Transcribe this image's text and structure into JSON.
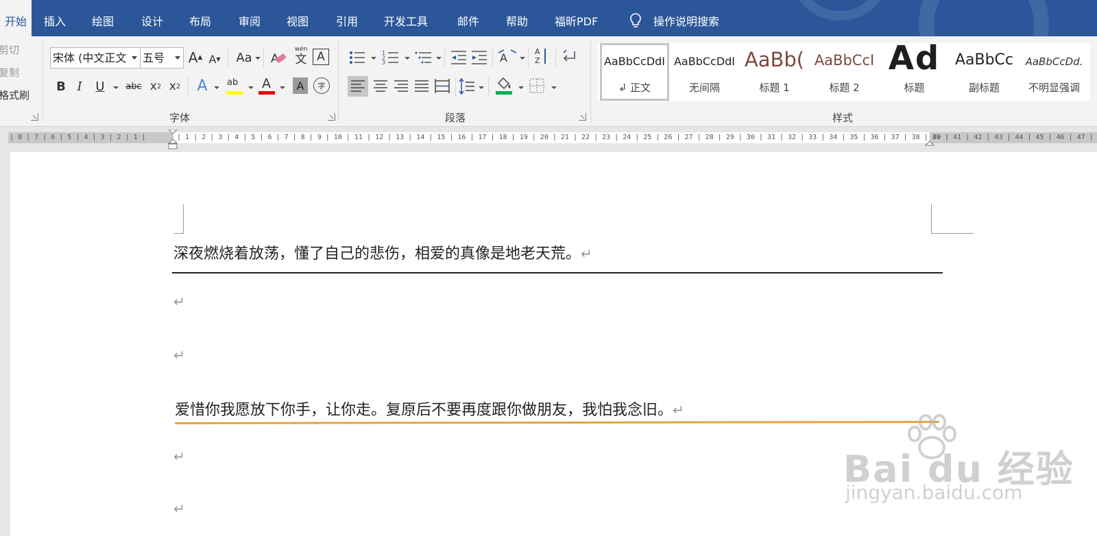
{
  "tabs": [
    {
      "label": "开始",
      "active": true
    },
    {
      "label": "插入"
    },
    {
      "label": "绘图"
    },
    {
      "label": "设计"
    },
    {
      "label": "布局"
    },
    {
      "label": "审阅"
    },
    {
      "label": "视图"
    },
    {
      "label": "引用"
    },
    {
      "label": "开发工具"
    },
    {
      "label": "邮件"
    },
    {
      "label": "帮助"
    },
    {
      "label": "福昕PDF"
    }
  ],
  "tell_me": {
    "label": "操作说明搜索",
    "icon": "lightbulb-icon"
  },
  "clipboard": {
    "cut": "剪切",
    "copy": "复制",
    "format_painter": "格式刷"
  },
  "font_group": {
    "label": "字体",
    "font_name": "宋体 (中文正文",
    "font_size": "五号",
    "grow": "A",
    "shrink": "A",
    "case": "Aa",
    "phonetic_top": "wén",
    "phonetic_char": "文",
    "border_char": "A",
    "bold": "B",
    "italic": "I",
    "underline": "U",
    "strike": "abc",
    "subscript": "x",
    "sub_mark": "2",
    "superscript": "x",
    "sup_mark": "2",
    "effects": "A",
    "highlight": "ab",
    "font_color": "A",
    "shading": "A",
    "enclose": "字"
  },
  "paragraph_group": {
    "label": "段落",
    "sort": "A Z"
  },
  "styles_group": {
    "label": "样式",
    "items": [
      {
        "preview": "AaBbCcDdI",
        "name": "↲ 正文"
      },
      {
        "preview": "AaBbCcDdI",
        "name": "无间隔"
      },
      {
        "preview": "AaBb(",
        "name": "标题 1"
      },
      {
        "preview": "AaBbCcI",
        "name": "标题 2"
      },
      {
        "preview": "Ad",
        "name": "标题"
      },
      {
        "preview": "AaBbCc",
        "name": "副标题"
      },
      {
        "preview": "AaBbCcDd.",
        "name": "不明显强调"
      }
    ]
  },
  "ruler": {
    "left_text": "| 8 | 7 | 6 | 5 | 4 | 3 | 2 | 1 |",
    "main_text": "| 1 | 2 | 3 | 4 | 5 | 6 | 7 | 8 | 9 | 10 | 11 | 12 | 13 | 14 | 15 | 16 | 17 | 18 | 19 | 20 | 21 | 22 | 23 | 24 | 25 | 26 | 27 | 28 | 29 | 30 | 31 | 32 | 33 | 34 | 35 | 36 | 37 | 38 | 39 |",
    "right_text": "40 | 41 | 42 | 43 | 44 | 45 | 46 | 47 | 48"
  },
  "document": {
    "line1": "深夜燃烧着放荡，懂了自己的悲伤，相爱的真像是地老天荒。",
    "line2": "爱惜你我愿放下你手，让你走。复原后不要再度跟你做朋友，我怕我念旧。",
    "para_mark": "↵"
  },
  "watermark": {
    "brand": "Bai du 经验",
    "url": "jingyan.baidu.com"
  },
  "colors": {
    "ribbon_tab_bar": "#2b579a",
    "underline_black": "#222222",
    "underline_orange": "#e8a33d",
    "font_color_red": "#e00000",
    "fill_green": "#00b050"
  }
}
